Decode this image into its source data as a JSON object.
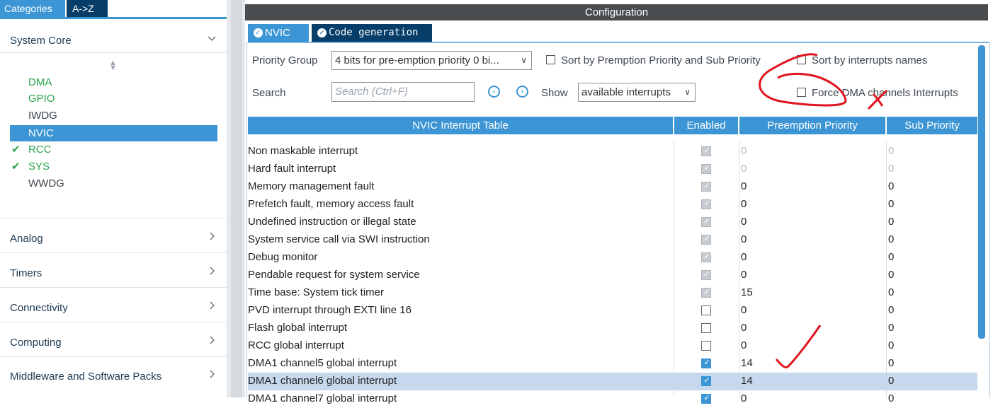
{
  "left_panel": {
    "tabs": {
      "categories": "Categories",
      "az": "A->Z"
    },
    "system_core": {
      "label": "System Core",
      "items": [
        {
          "label": "DMA",
          "status": "ok"
        },
        {
          "label": "GPIO",
          "status": "ok"
        },
        {
          "label": "IWDG",
          "status": "none"
        },
        {
          "label": "NVIC",
          "status": "selected"
        },
        {
          "label": "RCC",
          "status": "checked"
        },
        {
          "label": "SYS",
          "status": "checked"
        },
        {
          "label": "WWDG",
          "status": "none"
        }
      ]
    },
    "categories": [
      "Analog",
      "Timers",
      "Connectivity",
      "Computing",
      "Middleware and Software Packs"
    ]
  },
  "config": {
    "title": "Configuration",
    "tabs": {
      "nvic": "NVIC",
      "code": "Code generation"
    },
    "priority_group_label": "Priority Group",
    "priority_group_value": "4 bits for pre-emption priority 0 bi...",
    "sort_premption_label": "Sort by Premption Priority and Sub Priority",
    "sort_names_label": "Sort by interrupts names",
    "search_label": "Search",
    "search_placeholder": "Search (Ctrl+F)",
    "show_label": "Show",
    "show_value": "available interrupts",
    "force_dma_label": "Force DMA channels Interrupts"
  },
  "table": {
    "headers": [
      "NVIC Interrupt Table",
      "Enabled",
      "Preemption Priority",
      "Sub Priority"
    ],
    "rows": [
      {
        "name": "Non maskable interrupt",
        "enabled": "locked",
        "pre": "0",
        "sub": "0",
        "dim": true
      },
      {
        "name": "Hard fault interrupt",
        "enabled": "locked",
        "pre": "0",
        "sub": "0",
        "dim": true
      },
      {
        "name": "Memory management fault",
        "enabled": "locked",
        "pre": "0",
        "sub": "0",
        "dim": false
      },
      {
        "name": "Prefetch fault, memory access fault",
        "enabled": "locked",
        "pre": "0",
        "sub": "0",
        "dim": false
      },
      {
        "name": "Undefined instruction or illegal state",
        "enabled": "locked",
        "pre": "0",
        "sub": "0",
        "dim": false
      },
      {
        "name": "System service call via SWI instruction",
        "enabled": "locked",
        "pre": "0",
        "sub": "0",
        "dim": false
      },
      {
        "name": "Debug monitor",
        "enabled": "locked",
        "pre": "0",
        "sub": "0",
        "dim": false
      },
      {
        "name": "Pendable request for system service",
        "enabled": "locked",
        "pre": "0",
        "sub": "0",
        "dim": false
      },
      {
        "name": "Time base: System tick timer",
        "enabled": "locked",
        "pre": "15",
        "sub": "0",
        "dim": false
      },
      {
        "name": "PVD interrupt through EXTI line 16",
        "enabled": "off",
        "pre": "0",
        "sub": "0",
        "dim": false
      },
      {
        "name": "Flash global interrupt",
        "enabled": "off",
        "pre": "0",
        "sub": "0",
        "dim": false
      },
      {
        "name": "RCC global interrupt",
        "enabled": "off",
        "pre": "0",
        "sub": "0",
        "dim": false
      },
      {
        "name": "DMA1 channel5 global interrupt",
        "enabled": "on",
        "pre": "14",
        "sub": "0",
        "dim": false
      },
      {
        "name": "DMA1 channel6 global interrupt",
        "enabled": "on",
        "pre": "14",
        "sub": "0",
        "dim": false,
        "highlight": true
      },
      {
        "name": "DMA1 channel7 global interrupt",
        "enabled": "on",
        "pre": "0",
        "sub": "0",
        "dim": false
      }
    ]
  },
  "colors": {
    "accent": "#3c95d4",
    "dark_tab": "#063e69",
    "ok_green": "#2aa34a",
    "annotation_red": "#e0141e"
  }
}
